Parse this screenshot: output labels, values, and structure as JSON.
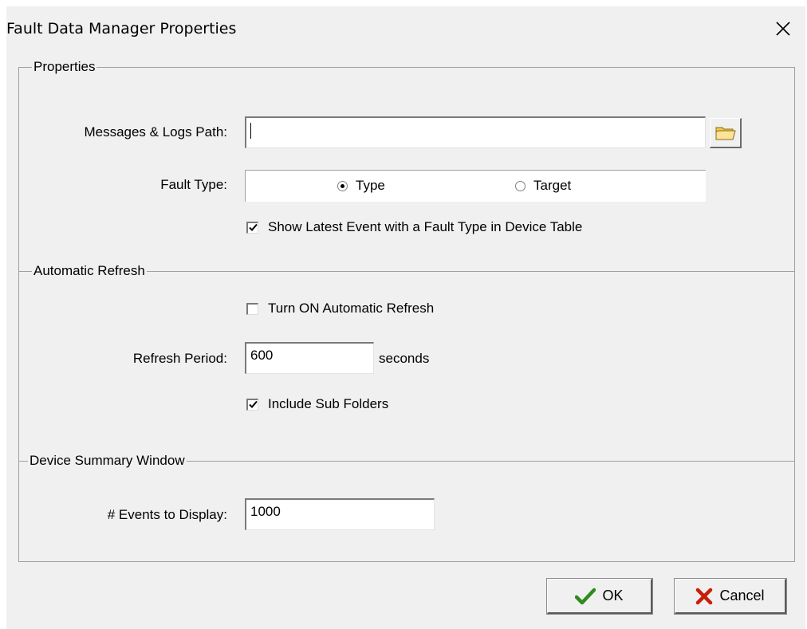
{
  "window": {
    "title": "Fault Data Manager Properties",
    "close_icon": "close-icon"
  },
  "sections": {
    "properties": {
      "legend": "Properties",
      "path_label": "Messages & Logs Path:",
      "path_value": "",
      "browse_icon": "folder-icon",
      "fault_type_label": "Fault Type:",
      "fault_type_options": [
        {
          "label": "Type",
          "checked": true
        },
        {
          "label": "Target",
          "checked": false
        }
      ],
      "show_latest_label": "Show Latest Event with a Fault Type in Device Table",
      "show_latest_checked": true
    },
    "refresh": {
      "legend": "Automatic Refresh",
      "auto_refresh_label": "Turn ON Automatic Refresh",
      "auto_refresh_checked": false,
      "period_label": "Refresh Period:",
      "period_value": "600",
      "period_unit": "seconds",
      "include_sub_label": "Include Sub Folders",
      "include_sub_checked": true
    },
    "summary": {
      "legend": "Device Summary Window",
      "events_label": "# Events to Display:",
      "events_value": "1000"
    }
  },
  "buttons": {
    "ok_label": "OK",
    "cancel_label": "Cancel"
  },
  "colors": {
    "dialog_bg": "#f0f0f0",
    "ok_check": "#2e8b1e",
    "cancel_x": "#c81e0a"
  }
}
